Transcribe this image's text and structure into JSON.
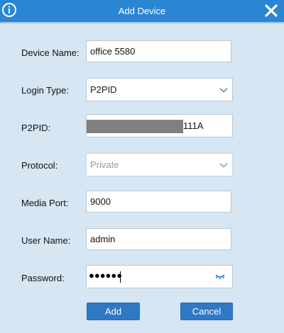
{
  "dialog": {
    "title": "Add Device",
    "icons": {
      "info": "info-icon",
      "close": "close-icon"
    }
  },
  "form": {
    "device_name": {
      "label": "Device Name:",
      "value": "office 5580"
    },
    "login_type": {
      "label": "Login Type:",
      "value": "P2PID"
    },
    "p2pid": {
      "label": "P2PID:",
      "visible_suffix": "111A"
    },
    "protocol": {
      "label": "Protocol:",
      "value": "Private"
    },
    "media_port": {
      "label": "Media Port:",
      "value": "9000"
    },
    "user_name": {
      "label": "User Name:",
      "value": "admin"
    },
    "password": {
      "label": "Password:",
      "masked_value": "●●●●●●"
    }
  },
  "buttons": {
    "add": "Add",
    "cancel": "Cancel"
  },
  "colors": {
    "titlebar": "#2a86d3",
    "background": "#d6e6f2",
    "button": "#2f78c4",
    "chevron": "#6b8aa3"
  }
}
